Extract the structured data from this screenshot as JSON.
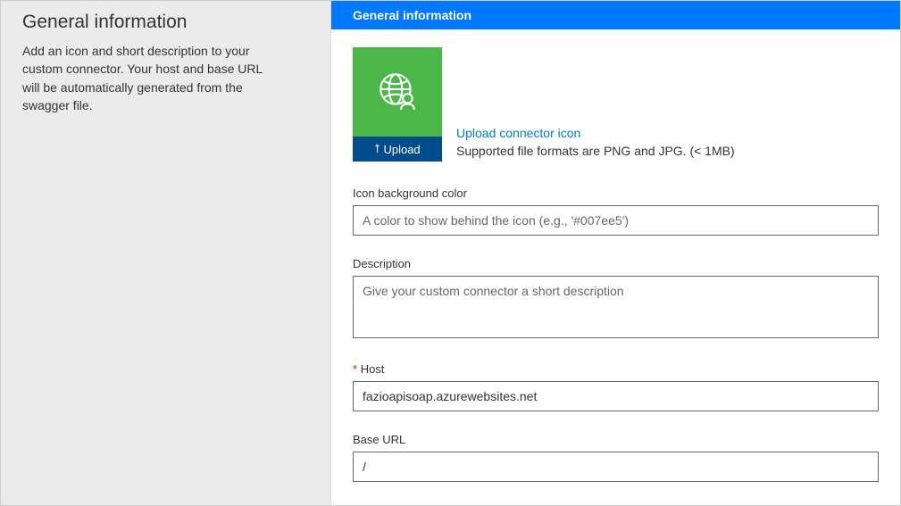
{
  "sidebar": {
    "title": "General information",
    "description": "Add an icon and short description to your custom connector. Your host and base URL will be automatically generated from the swagger file."
  },
  "main": {
    "header_title": "General information",
    "icon_section": {
      "upload_label": "Upload",
      "link_text": "Upload connector icon",
      "hint_text": "Supported file formats are PNG and JPG. (< 1MB)"
    },
    "fields": {
      "bgcolor": {
        "label": "Icon background color",
        "placeholder": "A color to show behind the icon (e.g., '#007ee5')",
        "value": ""
      },
      "description": {
        "label": "Description",
        "placeholder": "Give your custom connector a short description",
        "value": ""
      },
      "host": {
        "label": "Host",
        "required_mark": "*",
        "value": "fazioapisoap.azurewebsites.net"
      },
      "baseurl": {
        "label": "Base URL",
        "value": "/"
      }
    }
  }
}
